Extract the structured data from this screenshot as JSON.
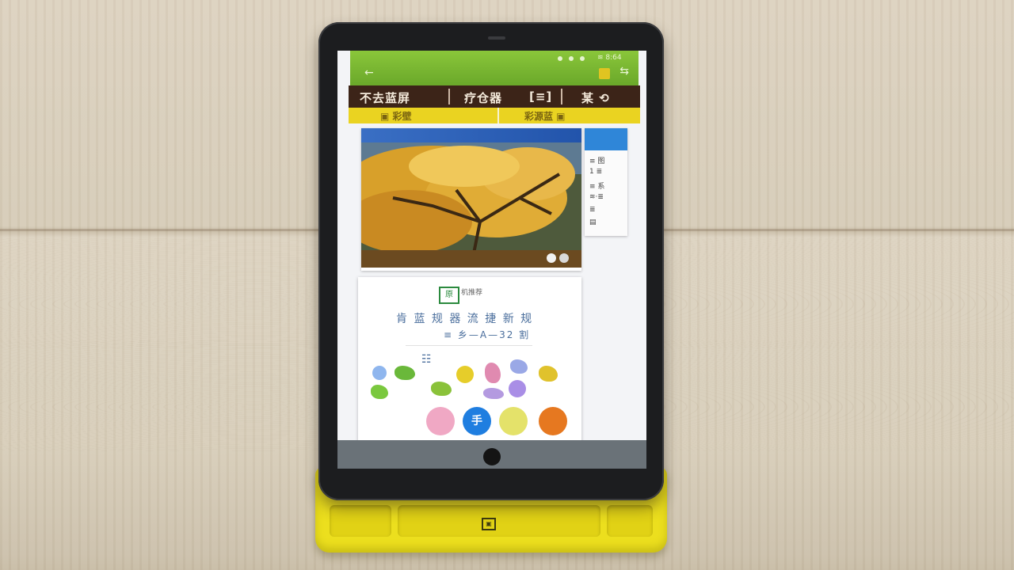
{
  "scene": {
    "surface": "light wooden table",
    "device": "tablet",
    "case_color": "#ecdf1e",
    "bezel_color": "#1c1d1f"
  },
  "tablet": {
    "statusbar_color": "#7ab834",
    "status_text": "≋ 8:64",
    "titlebar": {
      "left": "不去蓝屏",
      "middle": "疗仓器",
      "right_icon": "[≡]",
      "far_right": "某 ⟲"
    },
    "tabs": {
      "left": "▣ 彩壁",
      "right": "彩源蓝 ▣"
    },
    "side_card": {
      "rows": [
        "≡ 图",
        "1 ≣",
        "≡ 系",
        "≋·≣",
        "≣",
        "▤"
      ]
    },
    "info_card": {
      "logo": "原",
      "small_text": "机推荐",
      "line1": "肯 蓝 规 器 流 捷 新 规",
      "line2": "≡ 乡—A—32 割",
      "row_label": "☷",
      "bottom_button": "手"
    }
  },
  "case": {
    "logo": "▣"
  }
}
